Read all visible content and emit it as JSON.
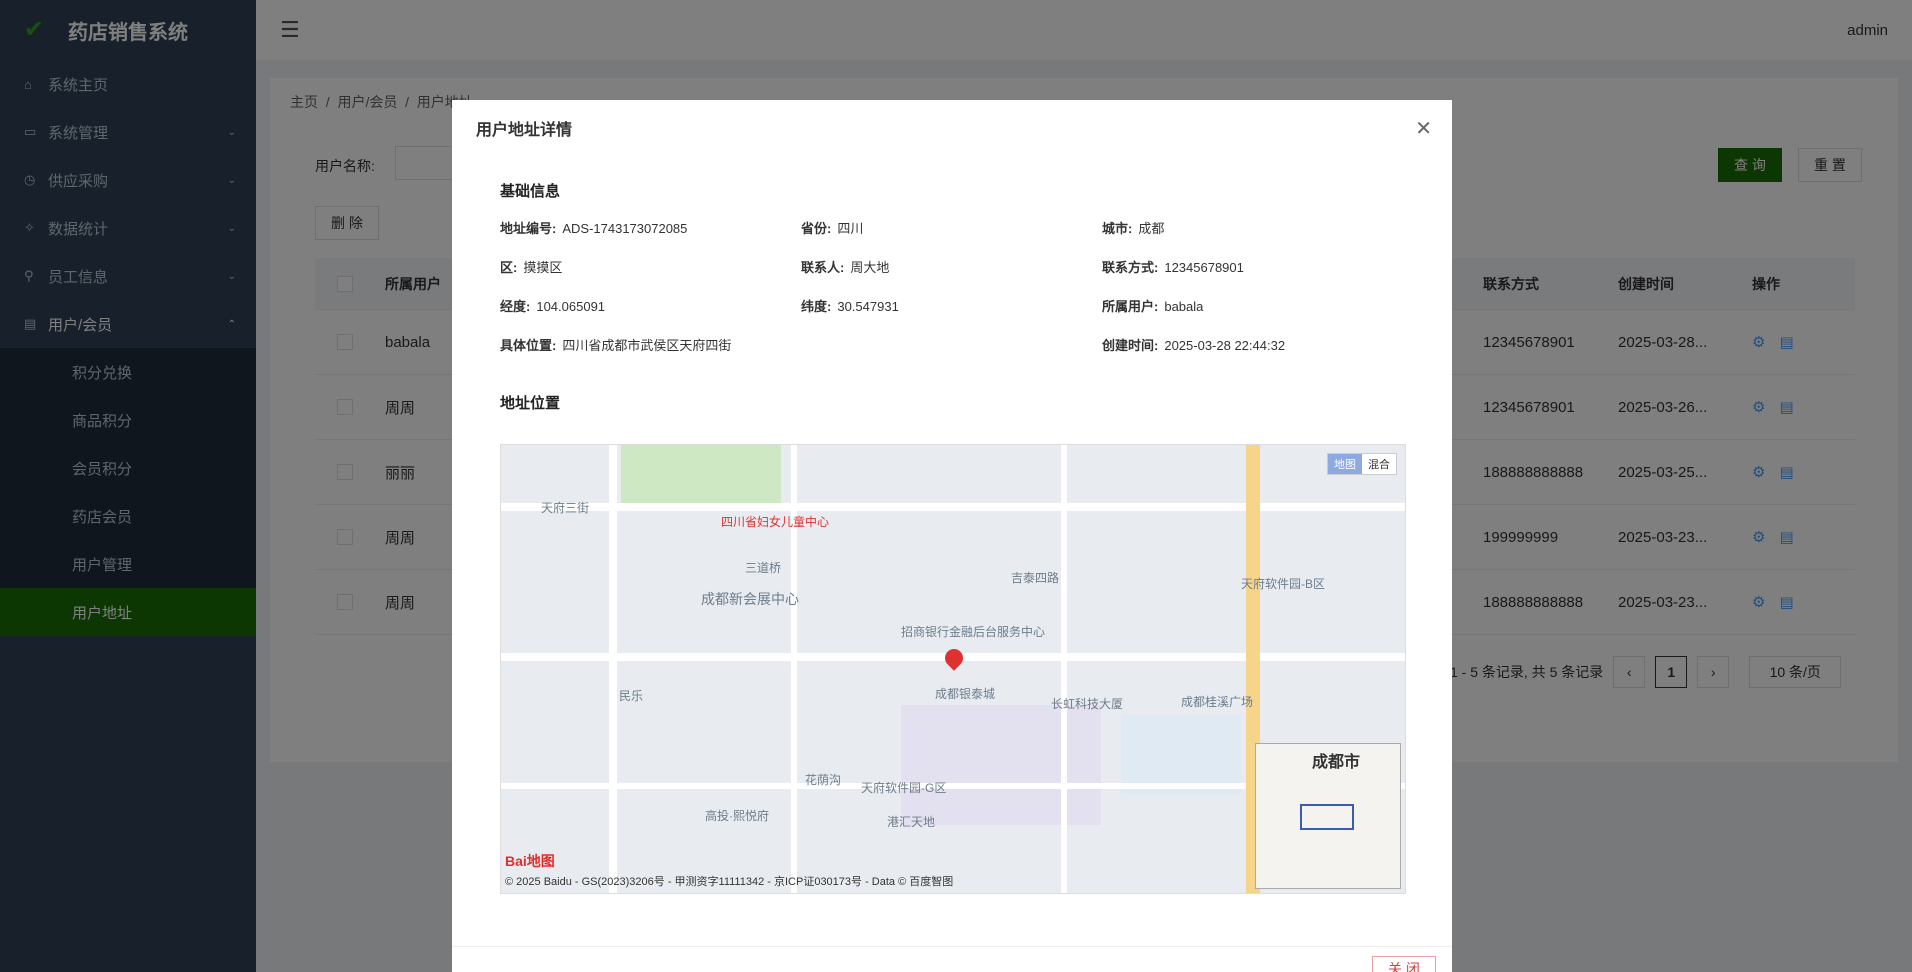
{
  "app": {
    "title": "药店销售系统",
    "user": "admin"
  },
  "sidebar": {
    "items": [
      {
        "label": "系统主页",
        "icon": "home-icon"
      },
      {
        "label": "系统管理",
        "icon": "monitor-icon"
      },
      {
        "label": "供应采购",
        "icon": "purchase-icon"
      },
      {
        "label": "数据统计",
        "icon": "pin-icon"
      },
      {
        "label": "员工信息",
        "icon": "link-icon"
      },
      {
        "label": "用户/会员",
        "icon": "document-icon"
      }
    ],
    "subs": [
      "积分兑换",
      "商品积分",
      "会员积分",
      "药店会员",
      "用户管理",
      "用户地址"
    ]
  },
  "breadcrumb": [
    "主页",
    "用户/会员",
    "用户地址"
  ],
  "filter": {
    "label": "用户名称:",
    "search": "查 询",
    "reset": "重 置",
    "delete": "删 除"
  },
  "table": {
    "headers": {
      "user": "所属用户",
      "phone": "联系方式",
      "time": "创建时间",
      "ops": "操作"
    },
    "rows": [
      {
        "user": "babala",
        "phone": "12345678901",
        "time": "2025-03-28..."
      },
      {
        "user": "周周",
        "phone": "12345678901",
        "time": "2025-03-26..."
      },
      {
        "user": "丽丽",
        "phone": "188888888888",
        "time": "2025-03-25..."
      },
      {
        "user": "周周",
        "phone": "199999999",
        "time": "2025-03-23..."
      },
      {
        "user": "周周",
        "phone": "188888888888",
        "time": "2025-03-23..."
      }
    ]
  },
  "pager": {
    "summary": "1 - 5 条记录, 共 5 条记录",
    "page": "1",
    "size": "10 条/页"
  },
  "modal": {
    "title": "用户地址详情",
    "basic": "基础信息",
    "location": "地址位置",
    "close": "关 闭",
    "fields": {
      "code_k": "地址编号:",
      "code_v": "ADS-1743173072085",
      "prov_k": "省份:",
      "prov_v": "四川",
      "city_k": "城市:",
      "city_v": "成都",
      "dist_k": "区:",
      "dist_v": "摸摸区",
      "contact_k": "联系人:",
      "contact_v": "周大地",
      "phone_k": "联系方式:",
      "phone_v": "12345678901",
      "lng_k": "经度:",
      "lng_v": "104.065091",
      "lat_k": "纬度:",
      "lat_v": "30.547931",
      "owner_k": "所属用户:",
      "owner_v": "babala",
      "addr_k": "具体位置:",
      "addr_v": "四川省成都市武侯区天府四街",
      "time_k": "创建时间:",
      "time_v": "2025-03-28 22:44:32"
    }
  },
  "map": {
    "type_map": "地图",
    "type_mix": "混合",
    "city": "成都市",
    "baidu": "Bai地图",
    "copyright": "© 2025 Baidu - GS(2023)3206号 - 甲测资字11111342 - 京ICP证030173号 - Data © 百度智图",
    "labels": [
      "天府三街",
      "三道桥",
      "成都新会展中心",
      "吉泰四路",
      "成都银泰城",
      "天府软件园-G区",
      "花荫沟",
      "高投·熙悦府",
      "港汇天地",
      "天府软件园-B区",
      "民乐",
      "四川省妇女儿童中心",
      "招商银行金融后台服务中心",
      "长虹科技大厦",
      "成都桂溪广场"
    ]
  }
}
